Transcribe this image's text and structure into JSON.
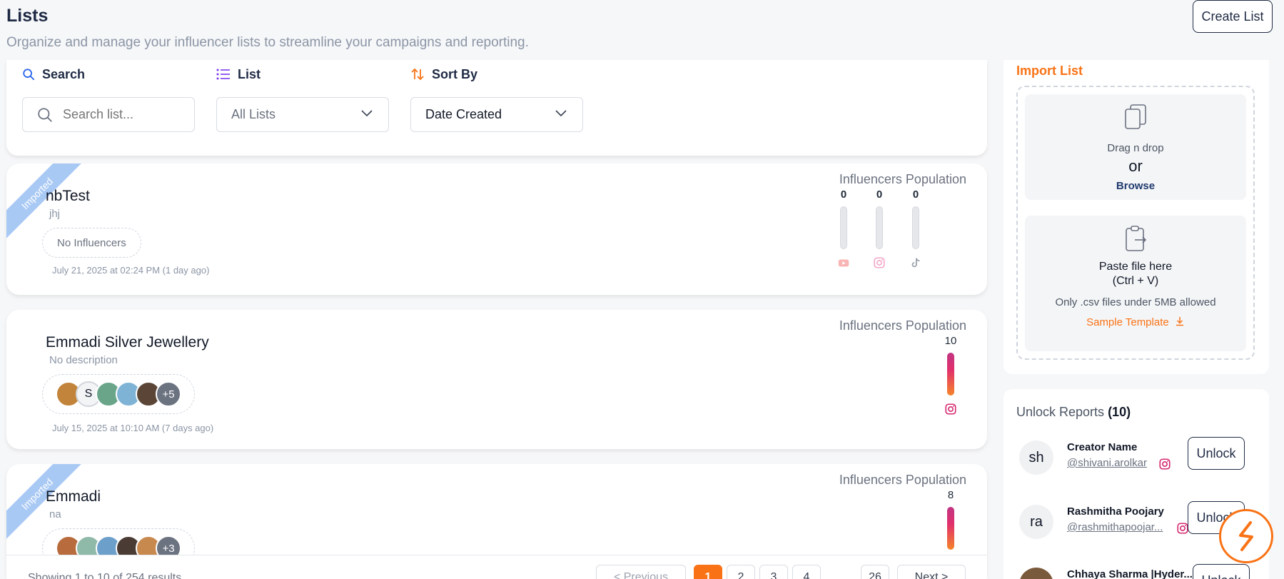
{
  "header": {
    "title": "Lists",
    "subtitle": "Organize and manage your influencer lists to streamline your campaigns and reporting.",
    "create_label": "Create List"
  },
  "filters": {
    "search_label": "Search",
    "search_placeholder": "Search list...",
    "list_label": "List",
    "list_value": "All Lists",
    "sort_label": "Sort By",
    "sort_value": "Date Created"
  },
  "lists": [
    {
      "ribbon": "Imported",
      "title": "nbTest",
      "description": "jhj",
      "influencers": "No Influencers",
      "date": "July 21, 2025 at 02:24 PM (1 day ago)",
      "population_title": "Influencers Population",
      "population": {
        "youtube": "0",
        "instagram": "0",
        "tiktok": "0"
      }
    },
    {
      "ribbon": "",
      "title": "Emmadi Silver Jewellery",
      "description": "No description",
      "avatar_letter": "S",
      "more": "+5",
      "date": "July 15, 2025 at 10:10 AM (7 days ago)",
      "population_title": "Influencers Population",
      "population": {
        "instagram": "10"
      }
    },
    {
      "ribbon": "Imported",
      "title": "Emmadi",
      "description": "na",
      "more": "+3",
      "population_title": "Influencers Population",
      "population": {
        "instagram": "8"
      }
    }
  ],
  "pagination": {
    "summary": "Showing 1 to 10 of 254 results",
    "previous": "< Previous",
    "pages": [
      "1",
      "2",
      "3",
      "4"
    ],
    "ellipsis": "...",
    "last": "26",
    "next": "Next >",
    "active_page": "1"
  },
  "import": {
    "title": "Import List",
    "drag": "Drag n drop",
    "or": "or",
    "browse": "Browse",
    "paste_line1": "Paste file here",
    "paste_line2": "(Ctrl + V)",
    "note": "Only .csv files under 5MB allowed",
    "template": "Sample Template"
  },
  "unlock": {
    "title": "Unlock Reports",
    "count": "(10)",
    "button": "Unlock",
    "items": [
      {
        "initials": "sh",
        "name": "Creator Name",
        "handle": "@shivani.arolkar"
      },
      {
        "initials": "ra",
        "name": "Rashmitha Poojary",
        "handle": "@rashmithapoojar..."
      },
      {
        "initials": "",
        "name": "Chhaya Sharma |Hyder...",
        "handle": ""
      }
    ]
  },
  "colors": {
    "accent": "#f97316",
    "navy": "#1f2a44",
    "ribbon": "#a9c9f5",
    "instagram": "#e1306c"
  }
}
